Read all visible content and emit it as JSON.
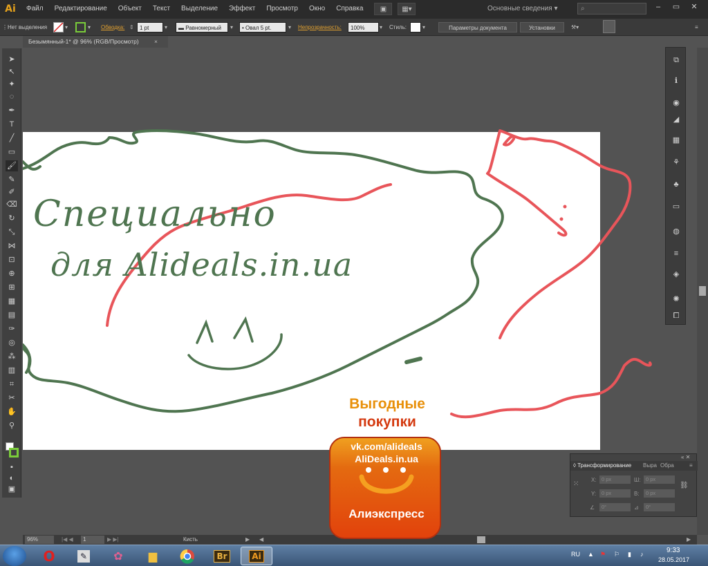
{
  "app": {
    "logo": "Ai",
    "menu": [
      "Файл",
      "Редактирование",
      "Объект",
      "Текст",
      "Выделение",
      "Эффект",
      "Просмотр",
      "Окно",
      "Справка"
    ],
    "workspace": "Основные сведения",
    "search_placeholder": "",
    "window_controls": [
      "–",
      "▭",
      "✕"
    ]
  },
  "control_bar": {
    "selection": "Нет выделения",
    "stroke_link": "Обводка:",
    "stroke_weight": "1 pt",
    "profile": "Равномерный",
    "brush": "Овал 5 pt.",
    "opacity_link": "Непрозрачность:",
    "opacity": "100%",
    "style_label": "Стиль:",
    "doc_setup": "Параметры документа",
    "preferences": "Установки"
  },
  "document": {
    "tab_title": "Безымянный-1* @ 96% (RGB/Просмотр)",
    "tab_close": "×"
  },
  "drawing": {
    "line1": "Специально",
    "line2": "для Alideals.in.ua",
    "green": "#4f7550",
    "red": "#e8555a"
  },
  "transform_panel": {
    "tab_active": "Трансформирование",
    "tab2": "Выра",
    "tab3": "Обра",
    "x_label": "X:",
    "y_label": "Y:",
    "w_label": "Ш:",
    "h_label": "В:",
    "x_value": "0 px",
    "y_value": "0 px",
    "w_value": "0 px",
    "h_value": "0 px",
    "angle_value": "0°",
    "shear_value": "0°"
  },
  "status_bar": {
    "zoom": "96%",
    "artboard": "1",
    "tool": "Кисть"
  },
  "watermark": {
    "title": "Выгодные",
    "subtitle": "покупки",
    "url": "vk.com/alideals",
    "site": "AliDeals.in.ua",
    "brand": "Алиэкспресс"
  },
  "taskbar": {
    "apps": [
      "Opera",
      "Notes",
      "Paint",
      "Explorer",
      "Chrome",
      "Br",
      "Ai"
    ],
    "lang": "RU",
    "time": "9:33",
    "date": "28.05.2017"
  }
}
